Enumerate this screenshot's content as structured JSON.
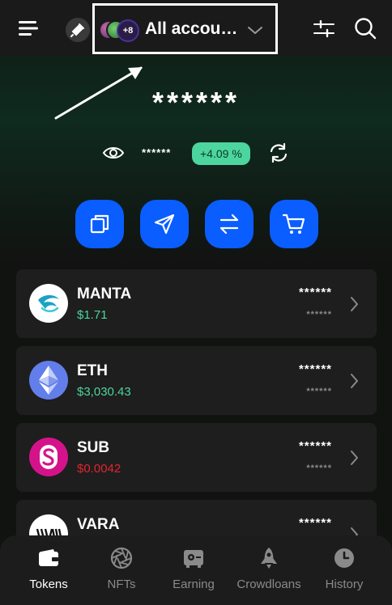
{
  "header": {
    "account_label": "All accou…",
    "avatars_more": "+8"
  },
  "balance": {
    "total_masked": "******",
    "sub_masked": "******",
    "change_percent": "+4.09 %"
  },
  "actions": [
    {
      "icon": "copy-icon"
    },
    {
      "icon": "send-icon"
    },
    {
      "icon": "swap-icon"
    },
    {
      "icon": "cart-icon"
    }
  ],
  "tokens": [
    {
      "symbol": "MANTA",
      "price": "$1.71",
      "price_color": "#4cd59f",
      "balance": "******",
      "value": "******",
      "logo": "manta-logo-icon"
    },
    {
      "symbol": "ETH",
      "price": "$3,030.43",
      "price_color": "#4cd59f",
      "balance": "******",
      "value": "******",
      "logo": "ethereum-logo-icon"
    },
    {
      "symbol": "SUB",
      "price": "$0.0042",
      "price_color": "#e0252d",
      "balance": "******",
      "value": "******",
      "logo": "subsocial-logo-icon"
    },
    {
      "symbol": "VARA",
      "price": "",
      "price_color": "#4cd59f",
      "balance": "******",
      "value": "",
      "logo": "vara-logo-icon"
    }
  ],
  "nav": [
    {
      "label": "Tokens",
      "icon": "wallet-icon",
      "active": true
    },
    {
      "label": "NFTs",
      "icon": "aperture-icon",
      "active": false
    },
    {
      "label": "Earning",
      "icon": "safe-icon",
      "active": false
    },
    {
      "label": "Crowdloans",
      "icon": "rocket-icon",
      "active": false
    },
    {
      "label": "History",
      "icon": "clock-icon",
      "active": false
    }
  ],
  "colors": {
    "accent": "#0a5dff",
    "positive": "#4cd59f",
    "negative": "#e0252d"
  }
}
